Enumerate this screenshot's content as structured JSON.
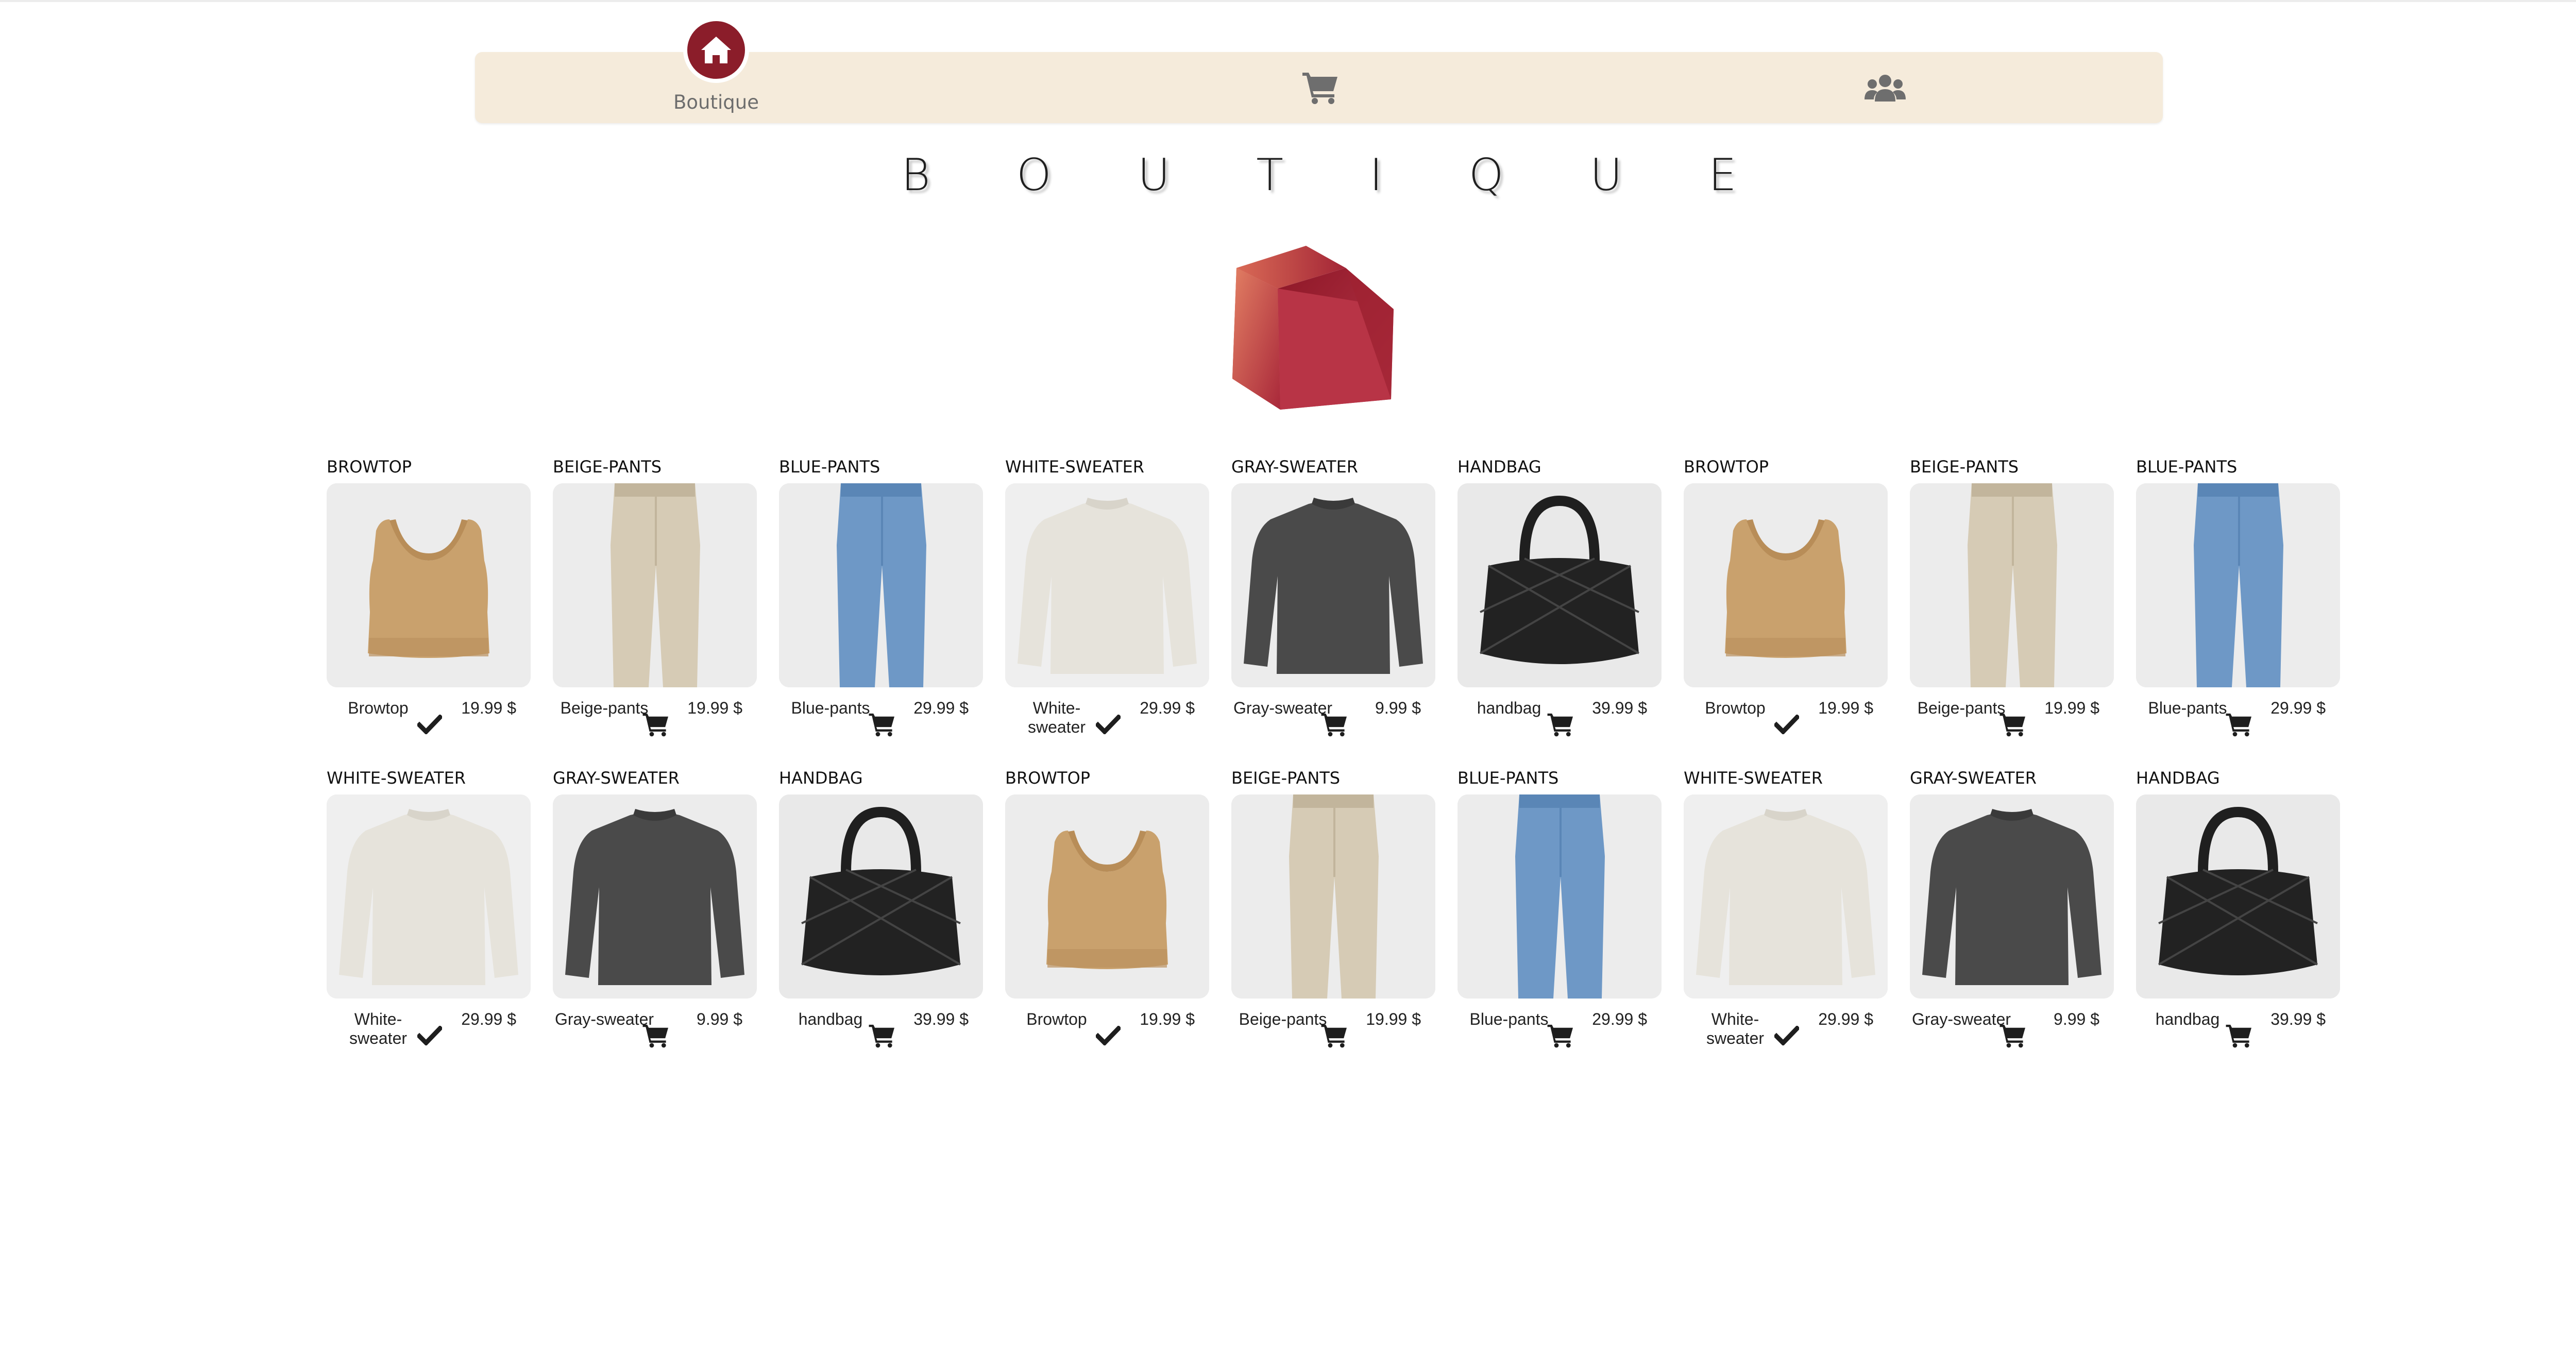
{
  "nav": {
    "items": [
      {
        "label": "Boutique",
        "icon": "home-icon",
        "active": true
      },
      {
        "label": "",
        "icon": "cart-icon",
        "active": false
      },
      {
        "label": "",
        "icon": "users-icon",
        "active": false
      }
    ]
  },
  "page": {
    "title": "B O U T I Q U E"
  },
  "colors": {
    "nav_bg": "#f5ebdb",
    "accent": "#8b1d2a",
    "cube_light": "#e07a5f",
    "cube_dark": "#9c1c2e"
  },
  "products": [
    {
      "name": "BROWTOP",
      "label": "Browtop",
      "price": "19.99 $",
      "kind": "top",
      "action": "check-icon"
    },
    {
      "name": "BEIGE-PANTS",
      "label": "Beige-pants",
      "price": "19.99 $",
      "kind": "beige",
      "action": "cart-icon"
    },
    {
      "name": "BLUE-PANTS",
      "label": "Blue-pants",
      "price": "29.99 $",
      "kind": "blue",
      "action": "cart-icon"
    },
    {
      "name": "WHITE-SWEATER",
      "label": "White-sweater",
      "price": "29.99 $",
      "kind": "white",
      "action": "check-icon"
    },
    {
      "name": "GRAY-SWEATER",
      "label": "Gray-sweater",
      "price": "9.99 $",
      "kind": "gray",
      "action": "cart-icon"
    },
    {
      "name": "HANDBAG",
      "label": "handbag",
      "price": "39.99 $",
      "kind": "bag",
      "action": "cart-icon"
    },
    {
      "name": "BROWTOP",
      "label": "Browtop",
      "price": "19.99 $",
      "kind": "top",
      "action": "check-icon"
    },
    {
      "name": "BEIGE-PANTS",
      "label": "Beige-pants",
      "price": "19.99 $",
      "kind": "beige",
      "action": "cart-icon"
    },
    {
      "name": "BLUE-PANTS",
      "label": "Blue-pants",
      "price": "29.99 $",
      "kind": "blue",
      "action": "cart-icon"
    },
    {
      "name": "WHITE-SWEATER",
      "label": "White-sweater",
      "price": "29.99 $",
      "kind": "white",
      "action": "check-icon"
    },
    {
      "name": "GRAY-SWEATER",
      "label": "Gray-sweater",
      "price": "9.99 $",
      "kind": "gray",
      "action": "cart-icon"
    },
    {
      "name": "HANDBAG",
      "label": "handbag",
      "price": "39.99 $",
      "kind": "bag",
      "action": "cart-icon"
    },
    {
      "name": "BROWTOP",
      "label": "Browtop",
      "price": "19.99 $",
      "kind": "top",
      "action": "check-icon"
    },
    {
      "name": "BEIGE-PANTS",
      "label": "Beige-pants",
      "price": "19.99 $",
      "kind": "beige",
      "action": "cart-icon"
    },
    {
      "name": "BLUE-PANTS",
      "label": "Blue-pants",
      "price": "29.99 $",
      "kind": "blue",
      "action": "cart-icon"
    },
    {
      "name": "WHITE-SWEATER",
      "label": "White-sweater",
      "price": "29.99 $",
      "kind": "white",
      "action": "check-icon"
    },
    {
      "name": "GRAY-SWEATER",
      "label": "Gray-sweater",
      "price": "9.99 $",
      "kind": "gray",
      "action": "cart-icon"
    },
    {
      "name": "HANDBAG",
      "label": "handbag",
      "price": "39.99 $",
      "kind": "bag",
      "action": "cart-icon"
    }
  ]
}
